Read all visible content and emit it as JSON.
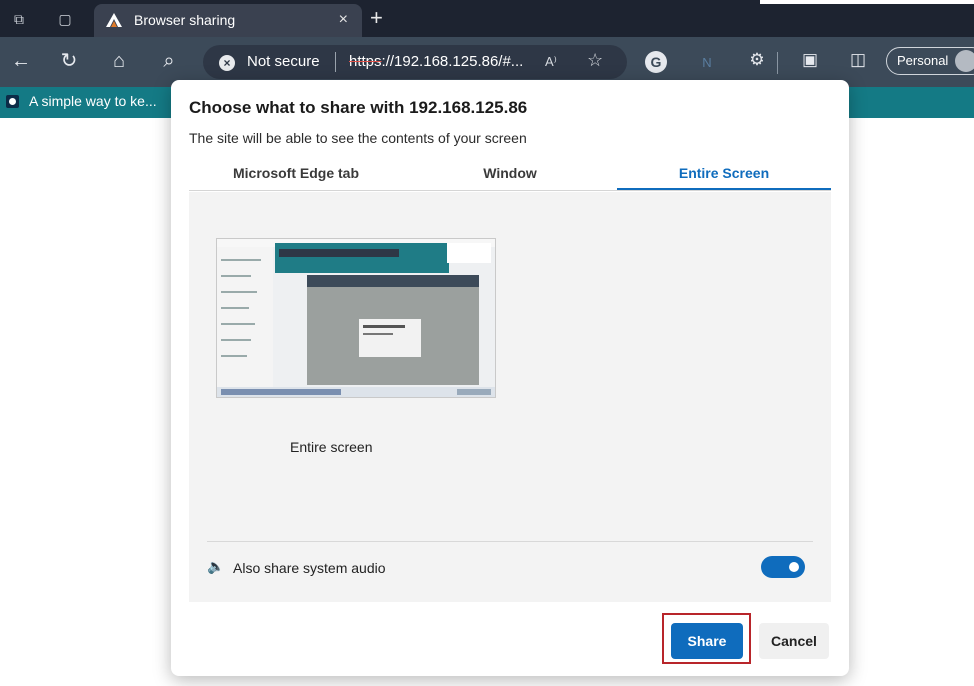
{
  "window": {
    "tab_title": "Browser sharing",
    "tab_close": "×",
    "new_tab": "+",
    "corner_text": "g"
  },
  "toolbar": {
    "back": "←",
    "refresh": "↻",
    "home": "⌂",
    "search": "⌕",
    "not_secure_label": "Not secure",
    "url_scheme": "https",
    "url_rest": "://192.168.125.86/#...",
    "read_aloud": "A⁾",
    "profile_label": "Personal"
  },
  "favorites": {
    "items": [
      {
        "label": "A simple way to ke..."
      }
    ]
  },
  "dialog": {
    "title": "Choose what to share with 192.168.125.86",
    "subtitle": "The site will be able to see the contents of your screen",
    "tabs": [
      {
        "label": "Microsoft Edge tab",
        "active": false
      },
      {
        "label": "Window",
        "active": false
      },
      {
        "label": "Entire Screen",
        "active": true
      }
    ],
    "screen_option_label": "Entire screen",
    "audio_label": "Also share system audio",
    "audio_enabled": true,
    "share_label": "Share",
    "cancel_label": "Cancel"
  },
  "colors": {
    "accent": "#0f6cbd",
    "favorites_bar": "#147a85",
    "highlight": "#b8252a"
  }
}
